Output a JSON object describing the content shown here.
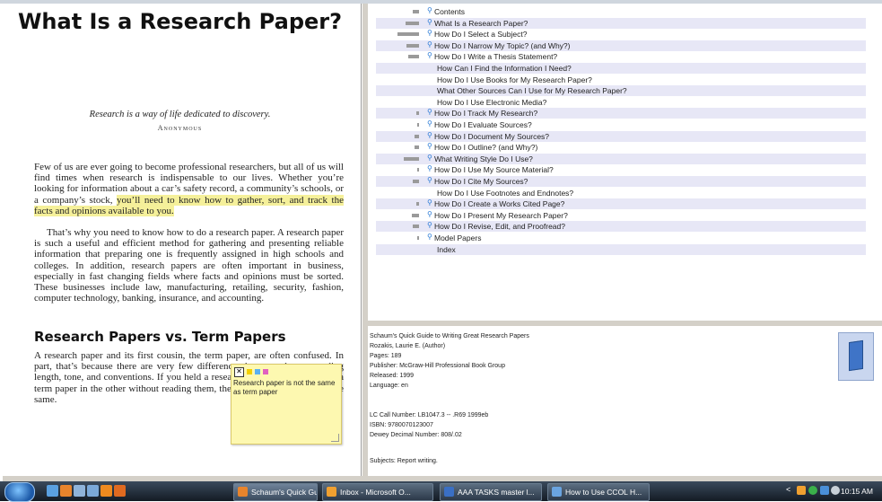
{
  "document": {
    "title": "What Is a Research Paper?",
    "epigraph": "Research is a way of life dedicated to discovery.",
    "epigraph_author": "Anonymous",
    "para1_a": "Few of us are ever going to become professional researchers, but all of us will find times when research is indispensable to our lives. Whether you’re looking for information about a car’s safety record, a community’s schools, or a company’s stock, ",
    "para1_highlight": "you’ll need to know how to gather, sort, and track the facts and opinions available to you.",
    "para2": "That’s why you need to know how to do a research paper. A research paper is such a useful and efficient method for gathering and presenting reliable information that preparing one is frequently assigned in high schools and colleges. In addition, research papers are often important in business, especially in fast changing fields where facts and opinions must be sorted. These businesses include law, manufacturing, retailing, security, fashion, computer technology, banking, insurance, and accounting.",
    "heading2": "Research Papers vs. Term Papers",
    "para3": "A research paper and its first cousin, the term paper, are often confused. In part, that’s because there are very few differences between them regarding length, tone, and conventions. If you held a research paper in one hand and a term paper in the other without reading them, the two would appear to be the same."
  },
  "sticky_note": {
    "close_glyph": "✕",
    "text": "Research paper is not the same as term paper",
    "colors": [
      "#f4d000",
      "#5ab0f0",
      "#e060c0"
    ]
  },
  "toc": [
    {
      "label": "Contents",
      "icon": "search-icon",
      "bar": 7,
      "indent": 0
    },
    {
      "label": "What Is a Research Paper?",
      "icon": "search-icon",
      "bar": 15,
      "indent": 0
    },
    {
      "label": "How Do I Select a Subject?",
      "icon": "search-icon",
      "bar": 24,
      "indent": 0
    },
    {
      "label": "How Do I Narrow My Topic? (and Why?)",
      "icon": "search-icon",
      "bar": 14,
      "indent": 0
    },
    {
      "label": "How Do I Write a Thesis Statement?",
      "icon": "search-icon",
      "bar": 12,
      "indent": 0
    },
    {
      "label": "How Can I Find the Information I Need?",
      "icon": "",
      "bar": 0,
      "indent": 1
    },
    {
      "label": "How Do I Use Books for My Research Paper?",
      "icon": "",
      "bar": 0,
      "indent": 1
    },
    {
      "label": "What Other Sources Can I Use for My Research Paper?",
      "icon": "",
      "bar": 0,
      "indent": 1
    },
    {
      "label": "How Do I Use Electronic Media?",
      "icon": "",
      "bar": 0,
      "indent": 1
    },
    {
      "label": "How Do I Track My Research?",
      "icon": "search-icon",
      "bar": 3,
      "indent": 0
    },
    {
      "label": "How Do I Evaluate Sources?",
      "icon": "search-icon",
      "bar": 2,
      "indent": 0
    },
    {
      "label": "How Do I Document My Sources?",
      "icon": "search-icon",
      "bar": 5,
      "indent": 0
    },
    {
      "label": "How Do I Outline? (and Why?)",
      "icon": "search-icon",
      "bar": 5,
      "indent": 0
    },
    {
      "label": "What Writing Style Do I Use?",
      "icon": "search-icon",
      "bar": 17,
      "indent": 0
    },
    {
      "label": "How Do I Use My Source Material?",
      "icon": "search-icon",
      "bar": 2,
      "indent": 0
    },
    {
      "label": "How Do I Cite My Sources?",
      "icon": "search-icon",
      "bar": 7,
      "indent": 0
    },
    {
      "label": "How Do I Use Footnotes and Endnotes?",
      "icon": "",
      "bar": 0,
      "indent": 1
    },
    {
      "label": "How Do I Create a Works Cited Page?",
      "icon": "search-icon",
      "bar": 3,
      "indent": 0
    },
    {
      "label": "How Do I Present My Research Paper?",
      "icon": "search-icon",
      "bar": 8,
      "indent": 0
    },
    {
      "label": "How Do I Revise, Edit, and Proofread?",
      "icon": "search-icon",
      "bar": 7,
      "indent": 0
    },
    {
      "label": "Model Papers",
      "icon": "search-icon",
      "bar": 2,
      "indent": 0
    },
    {
      "label": "Index",
      "icon": "",
      "bar": 0,
      "indent": 1
    }
  ],
  "book_info": {
    "title": "Schaum's Quick Guide to Writing Great Research Papers",
    "author": "Rozakis, Laurie E. (Author)",
    "pages_label": "Pages:",
    "pages": "189",
    "publisher_label": "Publisher:",
    "publisher": "McGraw-Hill Professional Book Group",
    "released_label": "Released:",
    "released": "1999",
    "language_label": "Language:",
    "language": "en",
    "lc_label": "LC Call Number:",
    "lc": "LB1047.3 -- .R69 1999eb",
    "isbn_label": "ISBN:",
    "isbn": "9780070123007",
    "dewey_label": "Dewey Decimal Number:",
    "dewey": "808/.02",
    "subjects_label": "Subjects:",
    "subjects": "Report writing."
  },
  "taskbar": {
    "quick_launch": [
      {
        "icon": "show-desktop-icon",
        "color": "#5aa0e0"
      },
      {
        "icon": "firefox-icon",
        "color": "#e8842c"
      },
      {
        "icon": "calculator-icon",
        "color": "#8fb3d9"
      },
      {
        "icon": "media-player-icon",
        "color": "#7aa8d8"
      },
      {
        "icon": "orange-app-icon",
        "color": "#ef8a1f"
      },
      {
        "icon": "firefox-icon",
        "color": "#e06a20"
      }
    ],
    "tasks": [
      {
        "label": "Schaum's Quick Gui...",
        "icon": "firefox-icon",
        "color": "#e8842c",
        "active": true
      },
      {
        "label": "Inbox - Microsoft O...",
        "icon": "outlook-icon",
        "color": "#f0a030",
        "active": false
      },
      {
        "label": "AAA TASKS master l...",
        "icon": "word-icon",
        "color": "#3a6fc4",
        "active": false
      },
      {
        "label": "How to Use CCOL H...",
        "icon": "window-icon",
        "color": "#6aa4e0",
        "active": false
      }
    ],
    "tray_expand": "<",
    "clock": "10:15 AM"
  }
}
